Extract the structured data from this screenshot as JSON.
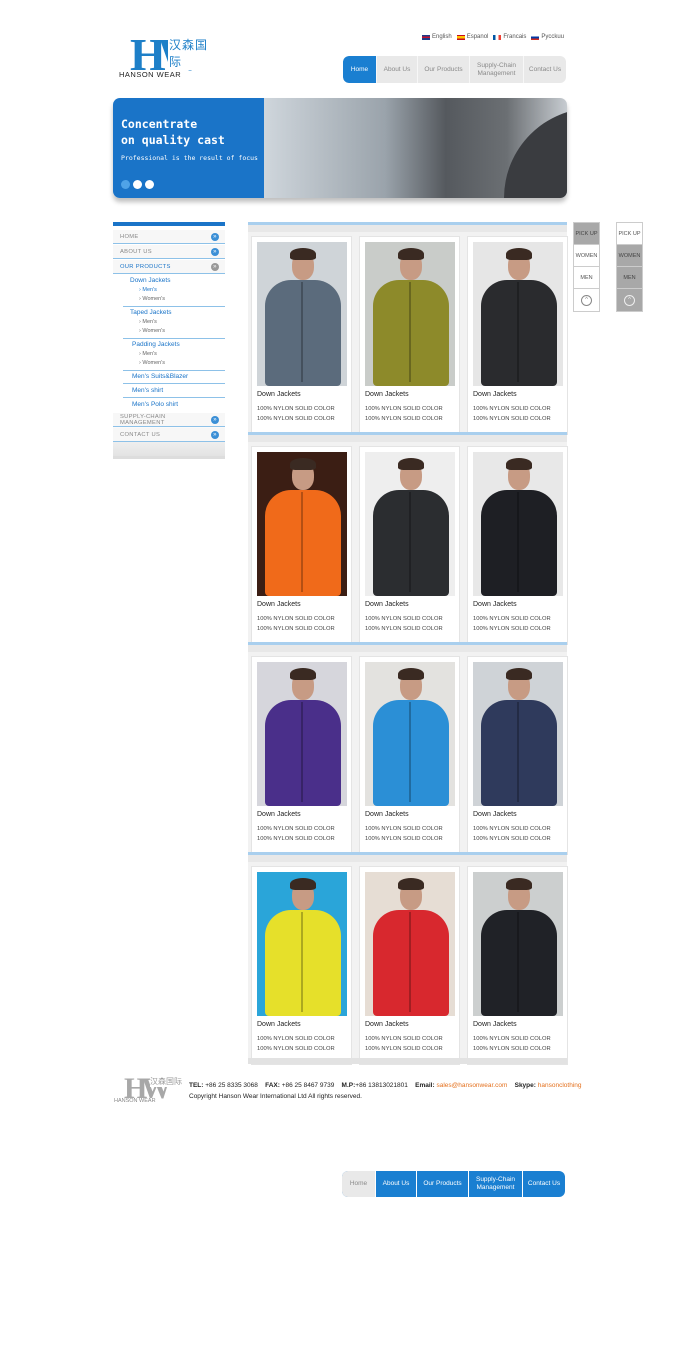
{
  "brand": {
    "mark": "HW",
    "cn": "汉森国际",
    "name": "HANSON WEAR"
  },
  "languages": [
    {
      "label": "English",
      "flag": [
        "#1f3c88",
        "#ffffff",
        "#c8102e"
      ]
    },
    {
      "label": "Espanol",
      "flag": [
        "#c60b1e",
        "#ffc400",
        "#c60b1e"
      ]
    },
    {
      "label": "Francais",
      "flag": [
        "#0055a4",
        "#ffffff",
        "#ef4135"
      ]
    },
    {
      "label": "Pycckuu",
      "flag": [
        "#ffffff",
        "#0039a6",
        "#d52b1e"
      ]
    }
  ],
  "nav": [
    "Home",
    "About Us",
    "Our Products",
    "Supply-Chain Management",
    "Contact Us"
  ],
  "banner": {
    "headline": "Concentrate\non quality cast",
    "sub": "Professional is the result of focus"
  },
  "sidebar": {
    "home": "HOME",
    "about": "ABOUT US",
    "products": "OUR PRODUCTS",
    "down": "Down Jackets",
    "taped": "Taped Jackets",
    "padding": "Padding Jackets",
    "mens": "Men's",
    "womens": "Women's",
    "suits": "Men's Suits&Blazer",
    "shirt": "Men's shirt",
    "polo": "Men's Polo shirt",
    "supply": "SUPPLY-CHAIN MANAGEMENT",
    "contact": "CONTACT US"
  },
  "products": {
    "title": "Down Jackets",
    "desc1": "100% NYLON SOLID COLOR",
    "desc2": "100% NYLON SOLID COLOR",
    "items": [
      {
        "coat": "#5b6b7c",
        "bg": "#cfd4d8"
      },
      {
        "coat": "#8d8a2a",
        "bg": "#c9ccc9"
      },
      {
        "coat": "#2a2b2e",
        "bg": "#e6e6e6"
      },
      {
        "coat": "#f06a1a",
        "bg": "#3b1e14"
      },
      {
        "coat": "#2b2d30",
        "bg": "#eeeeee"
      },
      {
        "coat": "#1e1f24",
        "bg": "#e8e8e8"
      },
      {
        "coat": "#4a2f8a",
        "bg": "#d6d6dc"
      },
      {
        "coat": "#2b8fd6",
        "bg": "#e3e2df"
      },
      {
        "coat": "#2f3a5c",
        "bg": "#cfd3d7"
      },
      {
        "coat": "#e6e02a",
        "bg": "#2aa5d9"
      },
      {
        "coat": "#d8282e",
        "bg": "#e6ddd4"
      },
      {
        "coat": "#202227",
        "bg": "#cccfcf"
      }
    ]
  },
  "side_tabs": {
    "pick": "PICK UP",
    "women": "WOMEN",
    "men": "MEN"
  },
  "footer": {
    "tel_label": "TEL:",
    "tel": "+86 25 8335 3068",
    "fax_label": "FAX:",
    "fax": "+86 25 8467 9739",
    "mp_label": "M.P:",
    "mp": "+86 13813021801",
    "email_label": "Email:",
    "email": "sales@hansonwear.com",
    "skype_label": "Skype:",
    "skype": "hansonclothing",
    "copyright": "Copyright  Hanson Wear International Ltd All rights reserved."
  }
}
